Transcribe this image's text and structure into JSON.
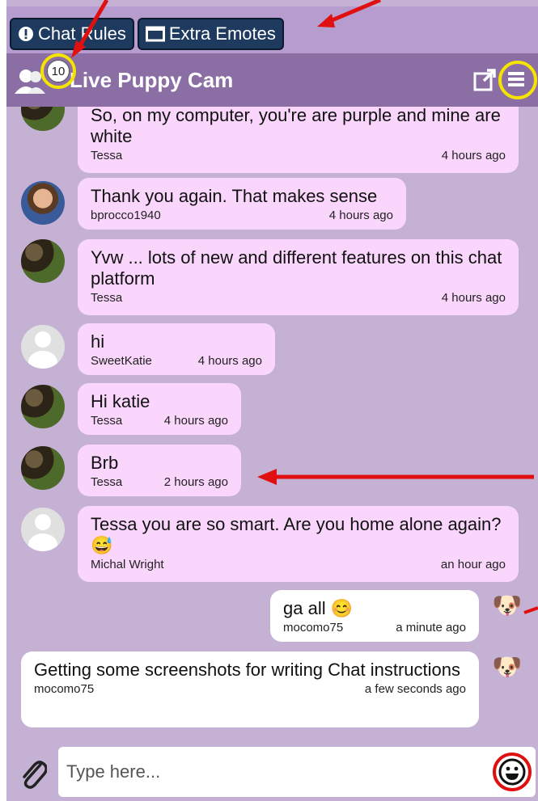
{
  "tabs": [
    {
      "label": "Chat Rules",
      "icon": "exclamation-circle-icon"
    },
    {
      "label": "Extra Emotes",
      "icon": "window-icon"
    }
  ],
  "header": {
    "user_count": "10",
    "title": "Live Puppy Cam"
  },
  "messages": [
    {
      "text": "So, on my computer, you're are purple and mine are white",
      "user": "Tessa",
      "time": "4 hours ago",
      "avatar": "dog"
    },
    {
      "text": "Thank you again. That makes sense",
      "user": "bprocco1940",
      "time": "4 hours ago",
      "avatar": "photo"
    },
    {
      "text": "Yvw ... lots of new and different features on this chat platform",
      "user": "Tessa",
      "time": "4 hours ago",
      "avatar": "dog"
    },
    {
      "text": "hi",
      "user": "SweetKatie",
      "time": "4 hours ago",
      "avatar": "default"
    },
    {
      "text": "Hi katie",
      "user": "Tessa",
      "time": "4 hours ago",
      "avatar": "dog"
    },
    {
      "text": "Brb",
      "user": "Tessa",
      "time": "2 hours ago",
      "avatar": "dog"
    },
    {
      "text": "Tessa you are so smart. Are you home alone again? 😅",
      "user": "Michal Wright",
      "time": "an hour ago",
      "avatar": "default"
    },
    {
      "text": "ga all 😊",
      "user": "mocomo75",
      "time": "a minute ago",
      "avatar": "puppy"
    },
    {
      "text": "Getting some screenshots for writing Chat instructions",
      "user": "mocomo75",
      "time": "a few seconds ago",
      "avatar": "puppy"
    }
  ],
  "input": {
    "placeholder": "Type here..."
  },
  "colors": {
    "panel": "#c4b1d4",
    "header": "#8b6fa4",
    "bubble_other": "#fad6fc",
    "bubble_self": "#ffffff",
    "tab_button": "#1e3a5f",
    "annotation_red": "#e01010",
    "annotation_yellow": "#f5e400"
  }
}
